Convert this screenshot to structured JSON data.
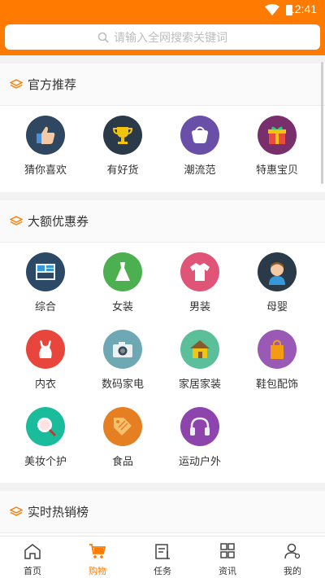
{
  "status": {
    "time": "12:41"
  },
  "search": {
    "placeholder": "请输入全网搜索关键词"
  },
  "sections": [
    {
      "title": "官方推荐",
      "items": [
        {
          "label": "猜你喜欢",
          "icon": "thumbs-up-icon",
          "color": "#2f4760"
        },
        {
          "label": "有好货",
          "icon": "trophy-icon",
          "color": "#2b3a49"
        },
        {
          "label": "潮流范",
          "icon": "purse-icon",
          "color": "#6a4fa8"
        },
        {
          "label": "特惠宝贝",
          "icon": "gift-icon",
          "color": "#7a2f6d"
        }
      ]
    },
    {
      "title": "大额优惠券",
      "items": [
        {
          "label": "综合",
          "icon": "dashboard-icon",
          "color": "#2c4a66"
        },
        {
          "label": "女装",
          "icon": "dress-icon",
          "color": "#4caf50"
        },
        {
          "label": "男装",
          "icon": "shirt-icon",
          "color": "#e05577"
        },
        {
          "label": "母婴",
          "icon": "baby-icon",
          "color": "#2b3a49"
        },
        {
          "label": "内衣",
          "icon": "underwear-icon",
          "color": "#e8453c"
        },
        {
          "label": "数码家电",
          "icon": "camera-icon",
          "color": "#6fa8b5"
        },
        {
          "label": "家居家装",
          "icon": "house-icon",
          "color": "#5bbf9a"
        },
        {
          "label": "鞋包配饰",
          "icon": "bag-icon",
          "color": "#9b59b6"
        },
        {
          "label": "美妆个护",
          "icon": "mirror-icon",
          "color": "#1abc9c"
        },
        {
          "label": "食品",
          "icon": "tag-icon",
          "color": "#e67e22"
        },
        {
          "label": "运动户外",
          "icon": "headphones-icon",
          "color": "#8e44ad"
        }
      ]
    },
    {
      "title": "实时热销榜"
    }
  ],
  "tabs": [
    {
      "label": "首页",
      "icon": "home-icon"
    },
    {
      "label": "购物",
      "icon": "cart-icon",
      "active": true
    },
    {
      "label": "任务",
      "icon": "task-icon"
    },
    {
      "label": "资讯",
      "icon": "grid-icon"
    },
    {
      "label": "我的",
      "icon": "user-icon"
    }
  ],
  "colors": {
    "brand": "#ff7a00",
    "section_icon": "#ff7a00"
  }
}
